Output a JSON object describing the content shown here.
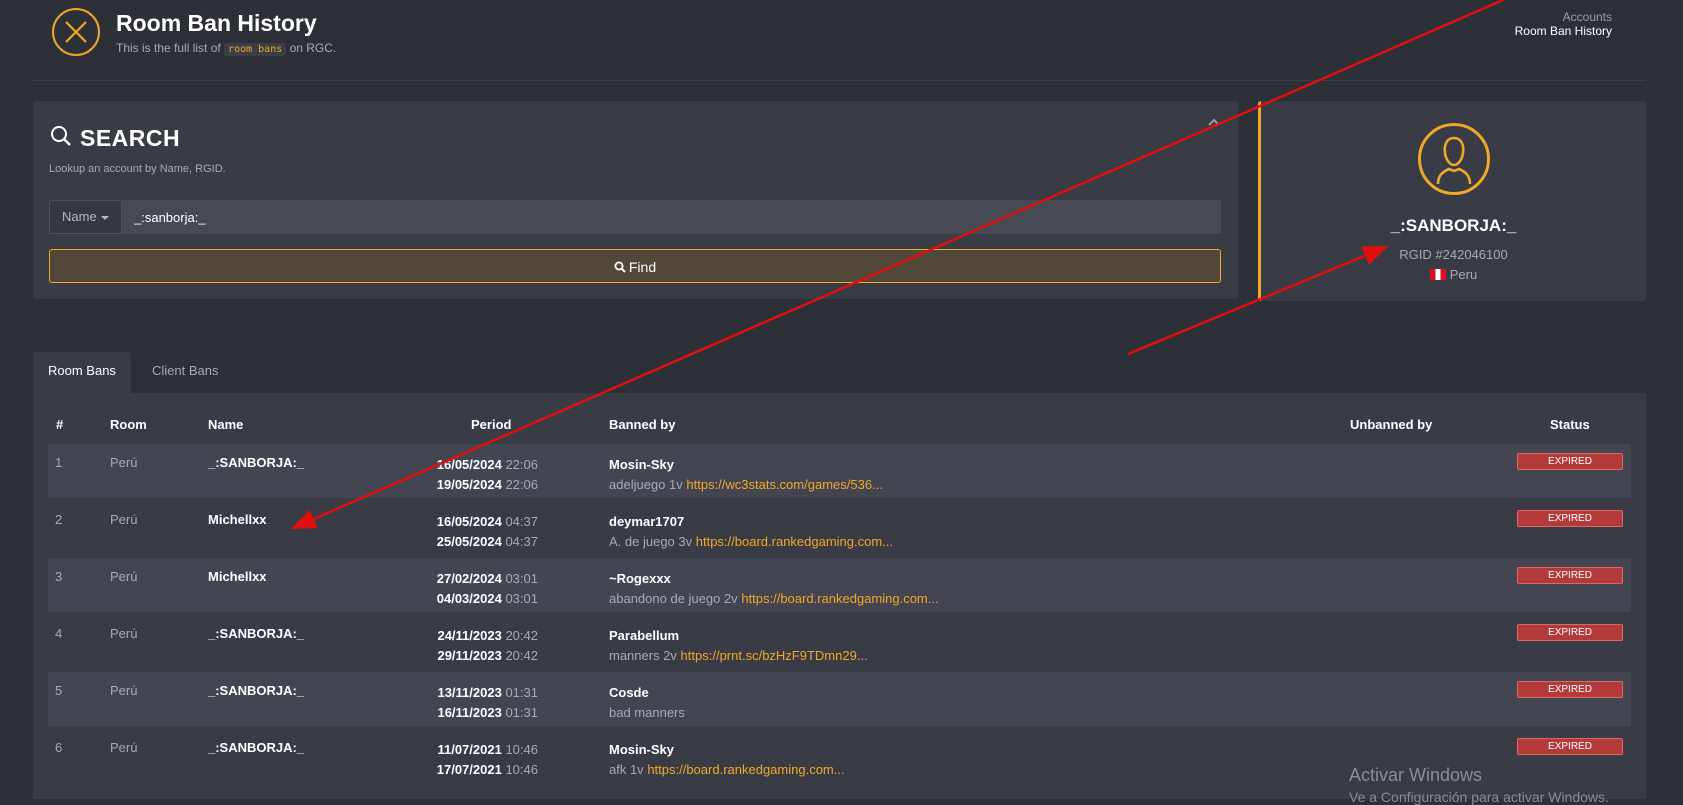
{
  "header": {
    "title": "Room Ban History",
    "subtitle_before": "This is the full list of",
    "subtitle_code": "room bans",
    "subtitle_after": "on RGC.",
    "breadcrumb_parent": "Accounts",
    "breadcrumb_current": "Room Ban History"
  },
  "search": {
    "title": "SEARCH",
    "description": "Lookup an account by Name, RGID.",
    "filter_label": "Name",
    "query": "_:sanborja:_",
    "find_label": "Find"
  },
  "profile": {
    "name": "_:SANBORJA:_",
    "rgid": "RGID #242046100",
    "country": "Peru"
  },
  "tabs": [
    {
      "label": "Room Bans",
      "active": true
    },
    {
      "label": "Client Bans",
      "active": false
    }
  ],
  "table": {
    "columns": {
      "num": "#",
      "room": "Room",
      "name": "Name",
      "period": "Period",
      "banned_by": "Banned by",
      "unbanned_by": "Unbanned by",
      "status": "Status"
    },
    "rows": [
      {
        "num": "1",
        "room": "Perú",
        "name": "_:SANBORJA:_",
        "start_date": "16/05/2024",
        "start_time": "22:06",
        "end_date": "19/05/2024",
        "end_time": "22:06",
        "banned_by": "Mosin-Sky",
        "reason": "adeljuego 1v",
        "link": "https://wc3stats.com/games/536...",
        "status": "EXPIRED"
      },
      {
        "num": "2",
        "room": "Perú",
        "name": "Michellxx",
        "start_date": "16/05/2024",
        "start_time": "04:37",
        "end_date": "25/05/2024",
        "end_time": "04:37",
        "banned_by": "deymar1707",
        "reason": "A. de juego 3v",
        "link": "https://board.rankedgaming.com...",
        "status": "EXPIRED"
      },
      {
        "num": "3",
        "room": "Perú",
        "name": "Michellxx",
        "start_date": "27/02/2024",
        "start_time": "03:01",
        "end_date": "04/03/2024",
        "end_time": "03:01",
        "banned_by": "~Rogexxx",
        "reason": "abandono de juego 2v",
        "link": "https://board.rankedgaming.com...",
        "status": "EXPIRED"
      },
      {
        "num": "4",
        "room": "Perú",
        "name": "_:SANBORJA:_",
        "start_date": "24/11/2023",
        "start_time": "20:42",
        "end_date": "29/11/2023",
        "end_time": "20:42",
        "banned_by": "Parabellum",
        "reason": "manners 2v",
        "link": "https://prnt.sc/bzHzF9TDmn29...",
        "status": "EXPIRED"
      },
      {
        "num": "5",
        "room": "Perú",
        "name": "_:SANBORJA:_",
        "start_date": "13/11/2023",
        "start_time": "01:31",
        "end_date": "16/11/2023",
        "end_time": "01:31",
        "banned_by": "Cosde",
        "reason": "bad manners",
        "link": "",
        "status": "EXPIRED"
      },
      {
        "num": "6",
        "room": "Perú",
        "name": "_:SANBORJA:_",
        "start_date": "11/07/2021",
        "start_time": "10:46",
        "end_date": "17/07/2021",
        "end_time": "10:46",
        "banned_by": "Mosin-Sky",
        "reason": "afk 1v",
        "link": "https://board.rankedgaming.com...",
        "status": "EXPIRED"
      }
    ]
  },
  "watermark": {
    "line1": "Activar Windows",
    "line2": "Ve a Configuración para activar Windows."
  },
  "colors": {
    "accent": "#f0a82a",
    "background": "#2e3038",
    "panel": "#3a3c45",
    "expired_badge": "#b33a3a",
    "annotation_arrow": "#e01010"
  }
}
